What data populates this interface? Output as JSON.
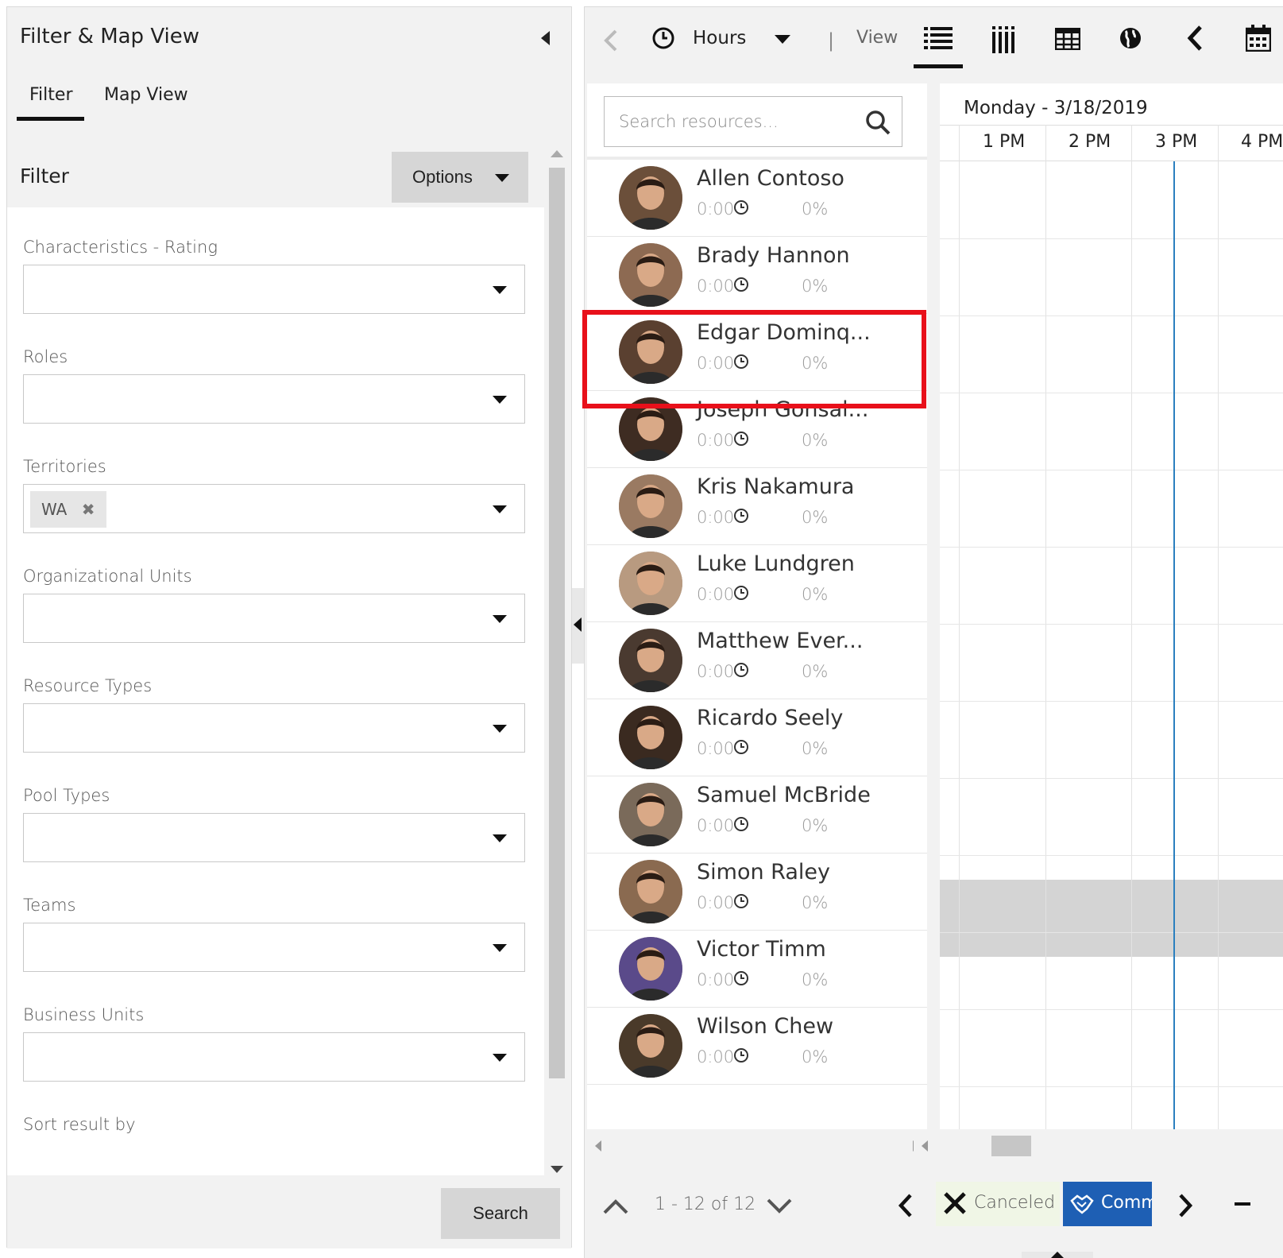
{
  "left_panel": {
    "title": "Filter & Map View",
    "tabs": [
      {
        "label": "Filter",
        "active": true
      },
      {
        "label": "Map View",
        "active": false
      }
    ],
    "filter_heading": "Filter",
    "options_label": "Options",
    "fields": [
      {
        "label": "Characteristics - Rating",
        "value": ""
      },
      {
        "label": "Roles",
        "value": ""
      },
      {
        "label": "Territories",
        "value": "",
        "chips": [
          "WA"
        ]
      },
      {
        "label": "Organizational Units",
        "value": ""
      },
      {
        "label": "Resource Types",
        "value": ""
      },
      {
        "label": "Pool Types",
        "value": ""
      },
      {
        "label": "Teams",
        "value": ""
      },
      {
        "label": "Business Units",
        "value": ""
      },
      {
        "label": "Sort result by",
        "value": ""
      }
    ],
    "search_label": "Search"
  },
  "toolbar": {
    "time_scale": "Hours",
    "separator": "|",
    "view_label": "View",
    "icons": [
      "back-arrow-icon",
      "clock-icon",
      "list-view-icon",
      "vertical-view-icon",
      "table-view-icon",
      "map-view-icon",
      "previous-icon",
      "calendar-icon"
    ]
  },
  "resources": {
    "search_placeholder": "Search resources...",
    "items": [
      {
        "name": "Allen Contoso",
        "time": "0:00",
        "percent": "0%"
      },
      {
        "name": "Brady Hannon",
        "time": "0:00",
        "percent": "0%"
      },
      {
        "name": "Edgar Dominq...",
        "time": "0:00",
        "percent": "0%"
      },
      {
        "name": "Joseph Gonsal...",
        "time": "0:00",
        "percent": "0%"
      },
      {
        "name": "Kris Nakamura",
        "time": "0:00",
        "percent": "0%"
      },
      {
        "name": "Luke Lundgren",
        "time": "0:00",
        "percent": "0%"
      },
      {
        "name": "Matthew Ever...",
        "time": "0:00",
        "percent": "0%"
      },
      {
        "name": "Ricardo Seely",
        "time": "0:00",
        "percent": "0%"
      },
      {
        "name": "Samuel McBride",
        "time": "0:00",
        "percent": "0%"
      },
      {
        "name": "Simon Raley",
        "time": "0:00",
        "percent": "0%"
      },
      {
        "name": "Victor Timm",
        "time": "0:00",
        "percent": "0%"
      },
      {
        "name": "Wilson Chew",
        "time": "0:00",
        "percent": "0%"
      }
    ]
  },
  "timeline": {
    "date": "Monday - 3/18/2019",
    "hours": [
      "1 PM",
      "2 PM",
      "3 PM",
      "4 PM"
    ]
  },
  "footer": {
    "page_label": "1 - 12 of 12",
    "legend": [
      {
        "label": "Canceled",
        "color": "#f0f6e6"
      },
      {
        "label": "Committed",
        "color": "#1e5fb4"
      }
    ]
  },
  "colors": {
    "highlight": "#e8101a",
    "now_line": "#2b7fbf"
  }
}
